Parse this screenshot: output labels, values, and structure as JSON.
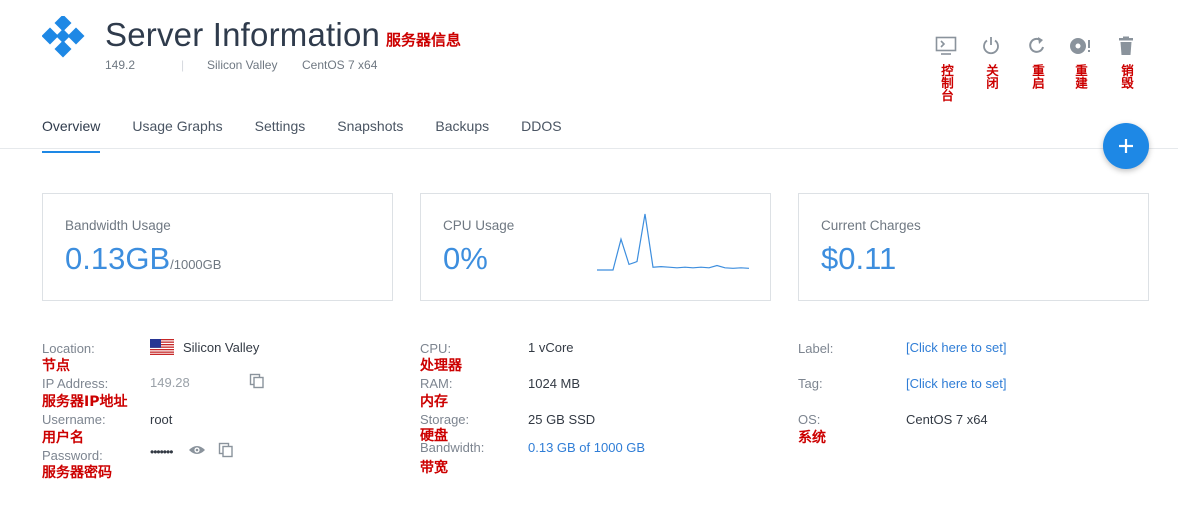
{
  "header": {
    "title": "Server Information",
    "title_cn": "服务器信息",
    "ip": "149.2",
    "location": "Silicon Valley",
    "os": "CentOS 7 x64",
    "separator": "|"
  },
  "actions": [
    {
      "icon": "console-icon",
      "label": "控制台"
    },
    {
      "icon": "power-icon",
      "label": "关闭"
    },
    {
      "icon": "restart-icon",
      "label": "重启"
    },
    {
      "icon": "reinstall-icon",
      "label": "重建"
    },
    {
      "icon": "trash-icon",
      "label": "销毁"
    }
  ],
  "tabs": [
    {
      "label": "Overview",
      "active": true
    },
    {
      "label": "Usage Graphs"
    },
    {
      "label": "Settings"
    },
    {
      "label": "Snapshots"
    },
    {
      "label": "Backups"
    },
    {
      "label": "DDOS"
    }
  ],
  "fab_label": "+",
  "cards": {
    "bandwidth": {
      "title": "Bandwidth Usage",
      "value": "0.13GB",
      "unit": "/1000GB"
    },
    "cpu": {
      "title": "CPU Usage",
      "value": "0%"
    },
    "charges": {
      "title": "Current Charges",
      "value": "$0.11"
    }
  },
  "cpu_sparkline": [
    0,
    0,
    0,
    0.55,
    0.1,
    0.15,
    1.0,
    0.05,
    0.06,
    0.05,
    0.04,
    0.05,
    0.04,
    0.05,
    0.04,
    0.08,
    0.04,
    0.03,
    0.04,
    0.03
  ],
  "col1": {
    "location_label": "Location:",
    "location_value": "Silicon Valley",
    "location_cn": "节点",
    "ip_label": "IP Address:",
    "ip_value": "149.28",
    "ip_cn": "服务器IP地址",
    "user_label": "Username:",
    "user_value": "root",
    "user_cn": "用户名",
    "pass_label": "Password:",
    "pass_value": "•••••••",
    "pass_cn": "服务器密码"
  },
  "col2": {
    "cpu_label": "CPU:",
    "cpu_value": "1 vCore",
    "cpu_cn": "处理器",
    "ram_label": "RAM:",
    "ram_value": "1024 MB",
    "ram_cn": "内存",
    "storage_label": "Storage:",
    "storage_value": "25 GB SSD",
    "storage_cn": "硬盘",
    "bw_label": "Bandwidth:",
    "bw_value": "0.13 GB of 1000 GB",
    "bw_cn": "带宽"
  },
  "col3": {
    "label_label": "Label:",
    "label_value": "[Click here to set]",
    "tag_label": "Tag:",
    "tag_value": "[Click here to set]",
    "os_label": "OS:",
    "os_value": "CentOS 7 x64",
    "os_cn": "系统"
  },
  "colors": {
    "accent": "#1e88e5",
    "annotation": "#cc0000",
    "logo": "#1e88e5"
  }
}
